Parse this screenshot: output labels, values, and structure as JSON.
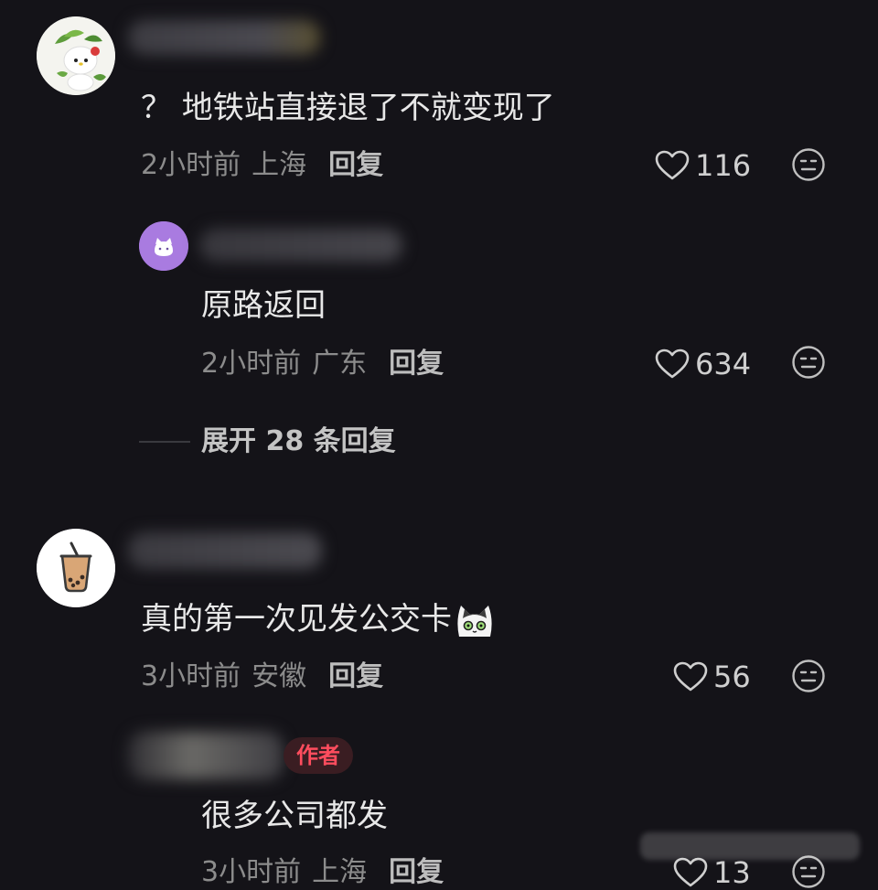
{
  "comments": [
    {
      "avatar": "hello-kitty-avatar",
      "text": "？ 地铁站直接退了不就变现了",
      "time": "2小时前",
      "location": "上海",
      "reply": "回复",
      "likes": "116",
      "replies": [
        {
          "avatar": "purple-cat-avatar",
          "text": "原路返回",
          "time": "2小时前",
          "location": "广东",
          "reply": "回复",
          "likes": "634"
        }
      ],
      "expand_label": "展开 28 条回复"
    },
    {
      "avatar": "bubble-tea-avatar",
      "text": "真的第一次见发公交卡",
      "emoji": "cat-face-emoji",
      "time": "3小时前",
      "location": "安徽",
      "reply": "回复",
      "likes": "56",
      "replies": [
        {
          "avatar": "blurred-avatar",
          "badge": "作者",
          "text": "很多公司都发",
          "time": "3小时前",
          "location": "上海",
          "reply": "回复",
          "likes": "13"
        }
      ]
    }
  ],
  "colors": {
    "background": "#141318",
    "author_badge": "#ff4d5e"
  }
}
